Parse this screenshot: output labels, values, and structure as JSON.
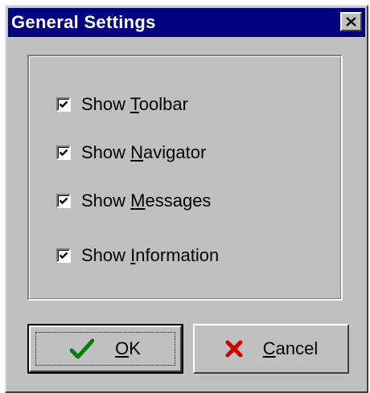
{
  "window": {
    "title": "General Settings",
    "close_icon": "close-icon"
  },
  "options": [
    {
      "pre": "Show ",
      "mnemonic": "T",
      "post": "oolbar",
      "checked": true
    },
    {
      "pre": "Show ",
      "mnemonic": "N",
      "post": "avigator",
      "checked": true
    },
    {
      "pre": "Show ",
      "mnemonic": "M",
      "post": "essages",
      "checked": true
    },
    {
      "pre": "Show ",
      "mnemonic": "I",
      "post": "nformation",
      "checked": true
    }
  ],
  "buttons": {
    "ok": {
      "mnemonic": "O",
      "post": "K",
      "icon": "green-checkmark-icon"
    },
    "cancel": {
      "mnemonic": "C",
      "post": "ancel",
      "icon": "red-x-icon"
    }
  },
  "colors": {
    "titlebar": "#000080",
    "face": "#c0c0c0",
    "ok_icon": "#008000",
    "cancel_icon": "#cc0000"
  }
}
